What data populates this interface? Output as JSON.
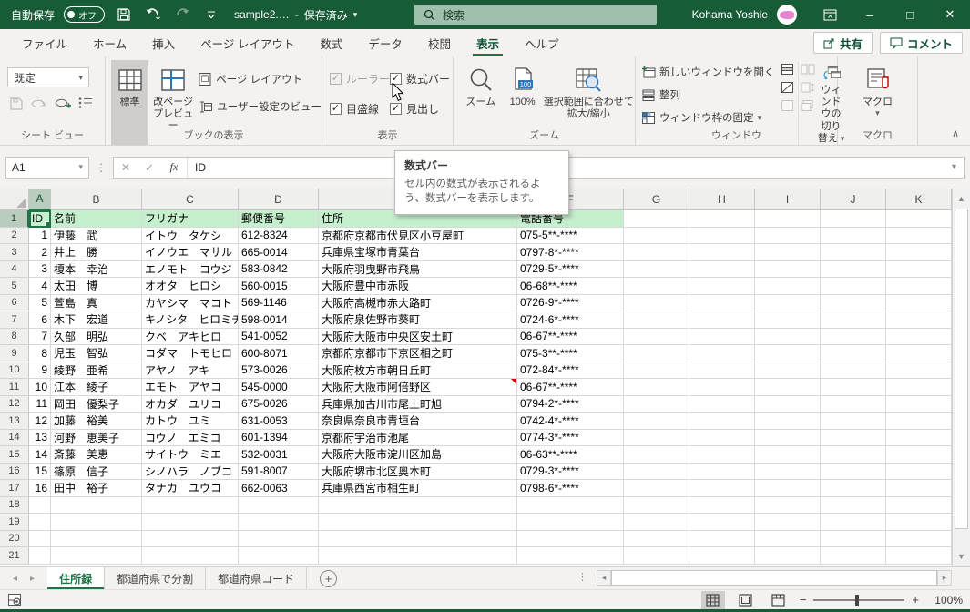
{
  "title_bar": {
    "autosave_label": "自動保存",
    "autosave_state": "オフ",
    "filename": "sample2.…",
    "dash": "-",
    "saved_status": "保存済み",
    "search_placeholder": "検索",
    "user_name": "Kohama Yoshie"
  },
  "ribbon": {
    "tabs": [
      {
        "label": "ファイル",
        "active": false
      },
      {
        "label": "ホーム",
        "active": false
      },
      {
        "label": "挿入",
        "active": false
      },
      {
        "label": "ページ レイアウト",
        "active": false
      },
      {
        "label": "数式",
        "active": false
      },
      {
        "label": "データ",
        "active": false
      },
      {
        "label": "校閲",
        "active": false
      },
      {
        "label": "表示",
        "active": true
      },
      {
        "label": "ヘルプ",
        "active": false
      }
    ],
    "share_label": "共有",
    "comments_label": "コメント",
    "groups": {
      "sheet_view": {
        "label": "シート ビュー",
        "default_view": "既定"
      },
      "workbook_views": {
        "label": "ブックの表示",
        "normal": "標準",
        "page_break_preview": "改ページ プレビュー",
        "page_layout": "ページ レイアウト",
        "custom_views": "ユーザー設定のビュー"
      },
      "show": {
        "label": "表示",
        "checkboxes": [
          {
            "label": "ルーラー",
            "checked": true,
            "disabled": true
          },
          {
            "label": "数式バー",
            "checked": true,
            "disabled": false
          },
          {
            "label": "目盛線",
            "checked": true,
            "disabled": false
          },
          {
            "label": "見出し",
            "checked": true,
            "disabled": false
          }
        ]
      },
      "zoom": {
        "label": "ズーム",
        "zoom": "ズーム",
        "hundred": "100%",
        "fit_selection": "選択範囲に合わせて拡大/縮小"
      },
      "window": {
        "label": "ウィンドウ",
        "new_window": "新しいウィンドウを開く",
        "arrange_all": "整列",
        "freeze_panes": "ウィンドウ枠の固定",
        "switch_windows": "ウィンドウの切り替え"
      },
      "macros": {
        "label": "マクロ",
        "button": "マクロ"
      }
    }
  },
  "tooltip": {
    "title": "数式バー",
    "body": "セル内の数式が表示されるよう、数式バーを表示します。"
  },
  "formula_bar": {
    "name_box": "A1",
    "fx_label": "fx",
    "content": "ID"
  },
  "grid": {
    "column_letters": [
      "A",
      "B",
      "C",
      "D",
      "E",
      "F",
      "G",
      "H",
      "I",
      "J",
      "K"
    ],
    "selected_cell": "A1",
    "visible_rows": 21,
    "header_row": [
      "ID",
      "名前",
      "フリガナ",
      "郵便番号",
      "住所",
      "電話番号"
    ],
    "records": [
      {
        "id": 1,
        "name": "伊藤　武",
        "kana": "イトウ　タケシ",
        "zip": "612-8324",
        "address": "京都府京都市伏見区小豆屋町",
        "phone": "075-5**-****",
        "comment": false
      },
      {
        "id": 2,
        "name": "井上　勝",
        "kana": "イノウエ　マサル",
        "zip": "665-0014",
        "address": "兵庫県宝塚市青葉台",
        "phone": "0797-8*-****",
        "comment": false
      },
      {
        "id": 3,
        "name": "榎本　幸治",
        "kana": "エノモト　コウジ",
        "zip": "583-0842",
        "address": "大阪府羽曳野市飛鳥",
        "phone": "0729-5*-****",
        "comment": false
      },
      {
        "id": 4,
        "name": "太田　博",
        "kana": "オオタ　ヒロシ",
        "zip": "560-0015",
        "address": "大阪府豊中市赤阪",
        "phone": "06-68**-****",
        "comment": false
      },
      {
        "id": 5,
        "name": "萱島　真",
        "kana": "カヤシマ　マコト",
        "zip": "569-1146",
        "address": "大阪府高槻市赤大路町",
        "phone": "0726-9*-****",
        "comment": false
      },
      {
        "id": 6,
        "name": "木下　宏道",
        "kana": "キノシタ　ヒロミチ",
        "zip": "598-0014",
        "address": "大阪府泉佐野市葵町",
        "phone": "0724-6*-****",
        "comment": false
      },
      {
        "id": 7,
        "name": "久部　明弘",
        "kana": "クベ　アキヒロ",
        "zip": "541-0052",
        "address": "大阪府大阪市中央区安土町",
        "phone": "06-67**-****",
        "comment": false
      },
      {
        "id": 8,
        "name": "児玉　智弘",
        "kana": "コダマ　トモヒロ",
        "zip": "600-8071",
        "address": "京都府京都市下京区相之町",
        "phone": "075-3**-****",
        "comment": false
      },
      {
        "id": 9,
        "name": "綾野　亜希",
        "kana": "アヤノ　アキ",
        "zip": "573-0026",
        "address": "大阪府枚方市朝日丘町",
        "phone": "072-84*-****",
        "comment": false
      },
      {
        "id": 10,
        "name": "江本　綾子",
        "kana": "エモト　アヤコ",
        "zip": "545-0000",
        "address": "大阪府大阪市阿倍野区",
        "phone": "06-67**-****",
        "comment": true
      },
      {
        "id": 11,
        "name": "岡田　優梨子",
        "kana": "オカダ　ユリコ",
        "zip": "675-0026",
        "address": "兵庫県加古川市尾上町旭",
        "phone": "0794-2*-****",
        "comment": false
      },
      {
        "id": 12,
        "name": "加藤　裕美",
        "kana": "カトウ　ユミ",
        "zip": "631-0053",
        "address": "奈良県奈良市青垣台",
        "phone": "0742-4*-****",
        "comment": false
      },
      {
        "id": 13,
        "name": "河野　恵美子",
        "kana": "コウノ　エミコ",
        "zip": "601-1394",
        "address": "京都府宇治市池尾",
        "phone": "0774-3*-****",
        "comment": false
      },
      {
        "id": 14,
        "name": "斎藤　美恵",
        "kana": "サイトウ　ミエ",
        "zip": "532-0031",
        "address": "大阪府大阪市淀川区加島",
        "phone": "06-63**-****",
        "comment": false
      },
      {
        "id": 15,
        "name": "篠原　信子",
        "kana": "シノハラ　ノブコ",
        "zip": "591-8007",
        "address": "大阪府堺市北区奥本町",
        "phone": "0729-3*-****",
        "comment": false
      },
      {
        "id": 16,
        "name": "田中　裕子",
        "kana": "タナカ　ユウコ",
        "zip": "662-0063",
        "address": "兵庫県西宮市相生町",
        "phone": "0798-6*-****",
        "comment": false
      }
    ]
  },
  "sheet_tabs": {
    "tabs": [
      {
        "label": "住所録",
        "active": true
      },
      {
        "label": "都道府県で分割",
        "active": false
      },
      {
        "label": "都道府県コード",
        "active": false
      }
    ]
  },
  "status_bar": {
    "zoom_level": "100%"
  },
  "glyphs": {
    "minimize": "–",
    "maximize": "□",
    "close": "✕",
    "dropdown": "▾",
    "chevron_up": "∧",
    "check": "✓",
    "nav_left": "◂",
    "nav_right": "▸",
    "up": "▲",
    "down": "▼",
    "dots": "⋮",
    "plus": "+",
    "minus": "−",
    "x_button": "✕",
    "enter_button": "✓"
  },
  "colors": {
    "title_bar_green": "#185c37",
    "accent_green": "#217346",
    "header_fill_green": "#c6efce",
    "selected_header": "#b9ccbd",
    "comment_red": "#e00000",
    "icon_blue": "#2e75b6"
  }
}
